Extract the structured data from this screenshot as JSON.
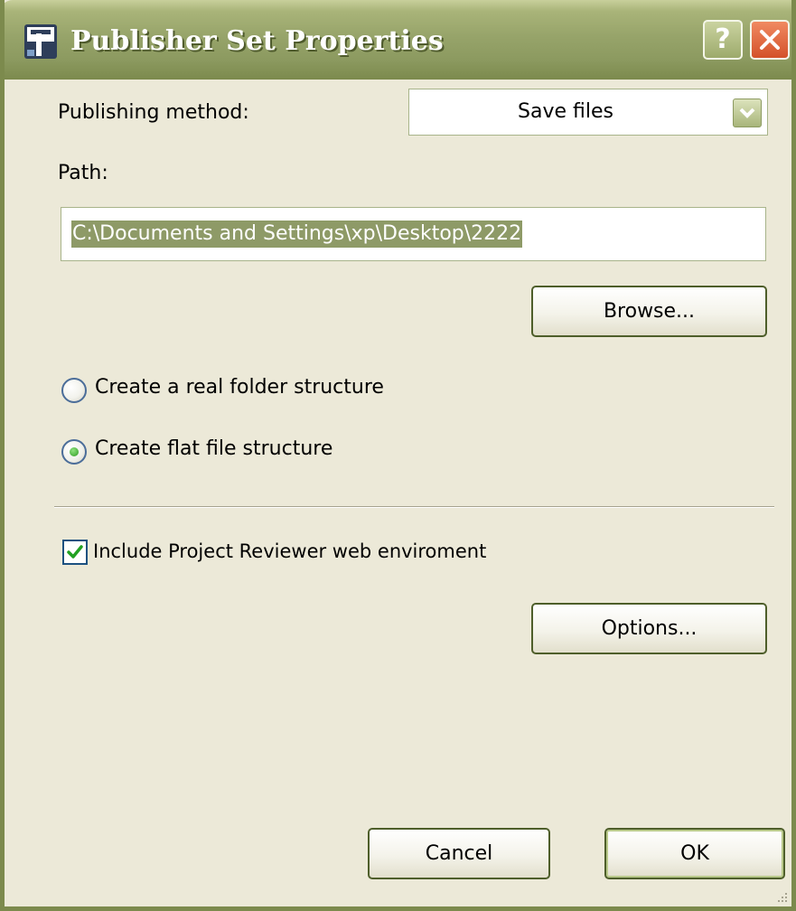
{
  "window": {
    "title": "Publisher Set Properties",
    "help_label": "?"
  },
  "publishing_method": {
    "label": "Publishing method:",
    "value": "Save files"
  },
  "path": {
    "label": "Path:",
    "value": "C:\\Documents and Settings\\xp\\Desktop\\2222"
  },
  "buttons": {
    "browse": "Browse...",
    "options": "Options...",
    "cancel": "Cancel",
    "ok": "OK"
  },
  "structure": {
    "real_folder_label": "Create a real folder structure",
    "flat_file_label": "Create flat file structure",
    "selected": "flat_file"
  },
  "include_reviewer": {
    "label": "Include Project Reviewer web enviroment",
    "checked": true
  },
  "icons": {
    "app": "publisher-app-icon",
    "close": "close-icon",
    "dropdown": "chevron-down-icon",
    "check": "checkmark-icon",
    "grip": "resize-grip-icon"
  },
  "colors": {
    "titlebar": "#97A46A",
    "dialog_bg": "#ECE9D8",
    "close": "#D4512A",
    "selection": "#8E9A67",
    "radio_dot": "#2F9A22",
    "check": "#21A121"
  }
}
